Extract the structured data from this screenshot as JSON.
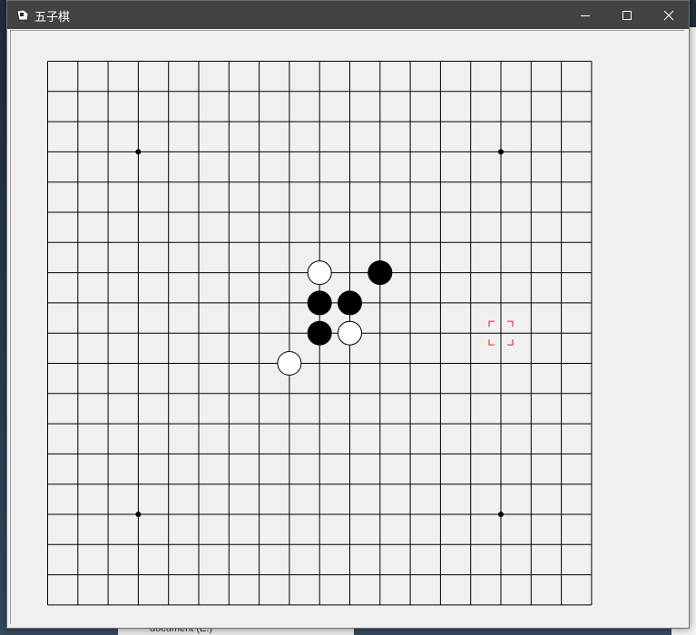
{
  "window": {
    "title": "五子棋",
    "icon": "gomoku-app-icon"
  },
  "controls": {
    "minimize_icon": "minimize-icon",
    "maximize_icon": "maximize-icon",
    "close_icon": "close-icon"
  },
  "board": {
    "grid_lines": 19,
    "line_color": "#000000",
    "background": "#f0f0f0",
    "star_points": [
      [
        3,
        3
      ],
      [
        15,
        3
      ],
      [
        3,
        15
      ],
      [
        15,
        15
      ]
    ],
    "stones": [
      {
        "col": 9,
        "row": 7,
        "color": "white"
      },
      {
        "col": 11,
        "row": 7,
        "color": "black"
      },
      {
        "col": 9,
        "row": 8,
        "color": "black"
      },
      {
        "col": 10,
        "row": 8,
        "color": "black"
      },
      {
        "col": 9,
        "row": 9,
        "color": "black"
      },
      {
        "col": 10,
        "row": 9,
        "color": "white"
      },
      {
        "col": 8,
        "row": 10,
        "color": "white"
      }
    ],
    "cursor": {
      "col": 15,
      "row": 9,
      "color": "#e53935"
    }
  },
  "background_app": {
    "bottom_text": "document (E:)"
  }
}
